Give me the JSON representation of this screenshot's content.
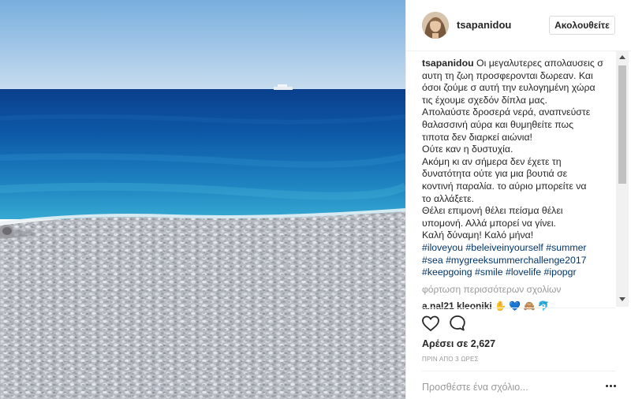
{
  "post": {
    "username": "tsapanidou",
    "follow_label": "Ακολουθείτε"
  },
  "caption": {
    "username": "tsapanidou",
    "lines": [
      " Οι μεγαλυτερες απολαυσεις σ",
      "αυτη τη ζωη προσφερονται δωρεαν. Και",
      "όσοι ζούμε σ αυτή την ευλογημένη χώρα",
      "τις έχουμε σχεδόν δίπλα μας.",
      "Απολαύστε δροσερά νερά, αναπνεύστε",
      "θαλασσινή αύρα και θυμηθείτε πως",
      "τιποτα δεν διαρκεί αιώνια!",
      "Ούτε καν η δυστυχία.",
      "Ακόμη κι αν σήμερα δεν έχετε τη",
      "δυνατότητα ούτε για μια βουτιά σε",
      "κοντινή παραλία. το αύριο μπορείτε να",
      "το αλλάξετε.",
      "Θέλει επιμονή θέλει πείσμα θέλει",
      "υπομονή. Αλλά μπορεί να γίνει.",
      "Καλή δύναμη! Καλό μήνα!"
    ],
    "hashtags": [
      [
        "#iloveyou",
        "#beleiveinyourself",
        "#summer"
      ],
      [
        "#sea",
        "#mygreeksummerchallenge2017"
      ],
      [
        "#keepgoing",
        "#smile",
        "#lovelife",
        "#ipopgr"
      ]
    ]
  },
  "load_more_label": "φόρτωση περισσότερων σχολίων",
  "next_comment": {
    "text": "a.nal21 kleoniki",
    "emoji": "✋ 💙 🙈 🐬"
  },
  "likes_label": "Αρέσει σε 2,627",
  "time_label": "ΠΡΙΝ ΑΠΟ 3 ΩΡΕΣ",
  "comment_placeholder": "Προσθέστε ένα σχόλιο...",
  "icons": {
    "like": "heart-icon",
    "comment": "comment-bubble-icon",
    "more": "more-dots-icon"
  },
  "colors": {
    "sky_top": "#7fb3de",
    "sky_horizon": "#c9def0",
    "sea_deep": "#0b4fa0",
    "sea_shallow": "#2a9cc8",
    "pebbles": "#b9bcc3",
    "hashtag": "#003569",
    "muted": "#999999"
  }
}
